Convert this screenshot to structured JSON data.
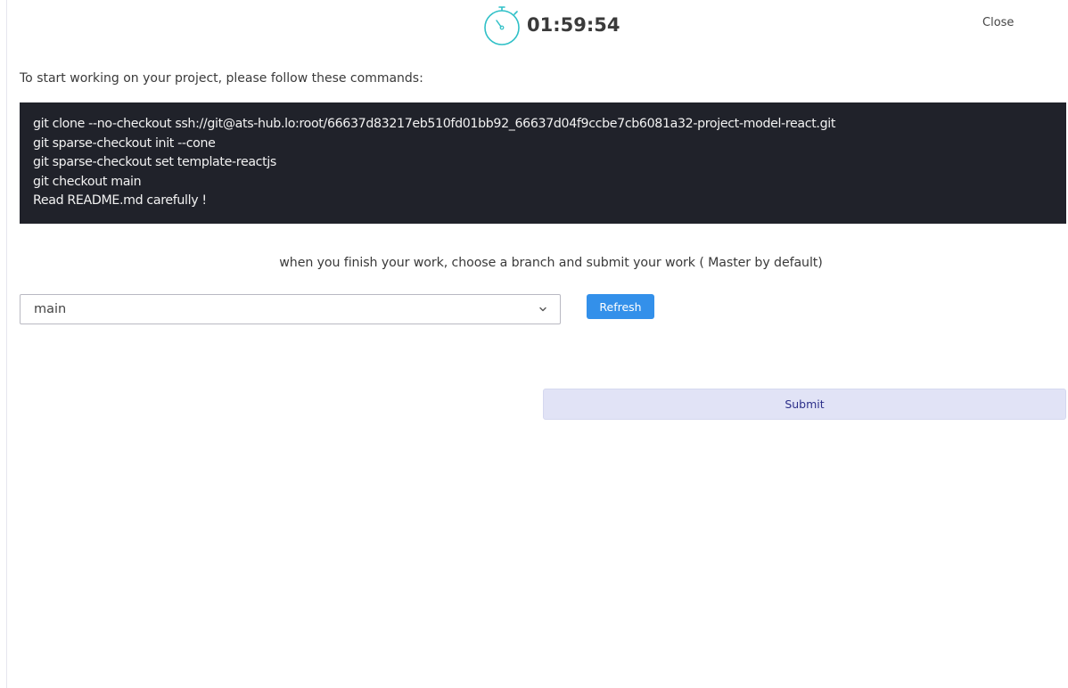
{
  "header": {
    "timer_icon": "stopwatch-icon",
    "timer_value": "01:59:54",
    "close_label": "Close"
  },
  "instructions": {
    "intro": "To start working on your project, please follow these commands:",
    "commands": [
      "git clone --no-checkout ssh://git@ats-hub.lo:root/66637d83217eb510fd01bb92_66637d04f9ccbe7cb6081a32-project-model-react.git",
      "git sparse-checkout init --cone",
      "git sparse-checkout set template-reactjs",
      "git checkout main",
      "Read README.md carefully !"
    ]
  },
  "submission": {
    "hint": "when you finish your work, choose a branch and submit your work ( Master by default)",
    "branch_selected": "main",
    "refresh_label": "Refresh",
    "submit_label": "Submit"
  },
  "colors": {
    "code_background": "#20222a",
    "timer_accent": "#2fc0c7",
    "refresh_button": "#3390ea",
    "submit_background": "#e1e3f6",
    "submit_text": "#2c2f8a"
  }
}
